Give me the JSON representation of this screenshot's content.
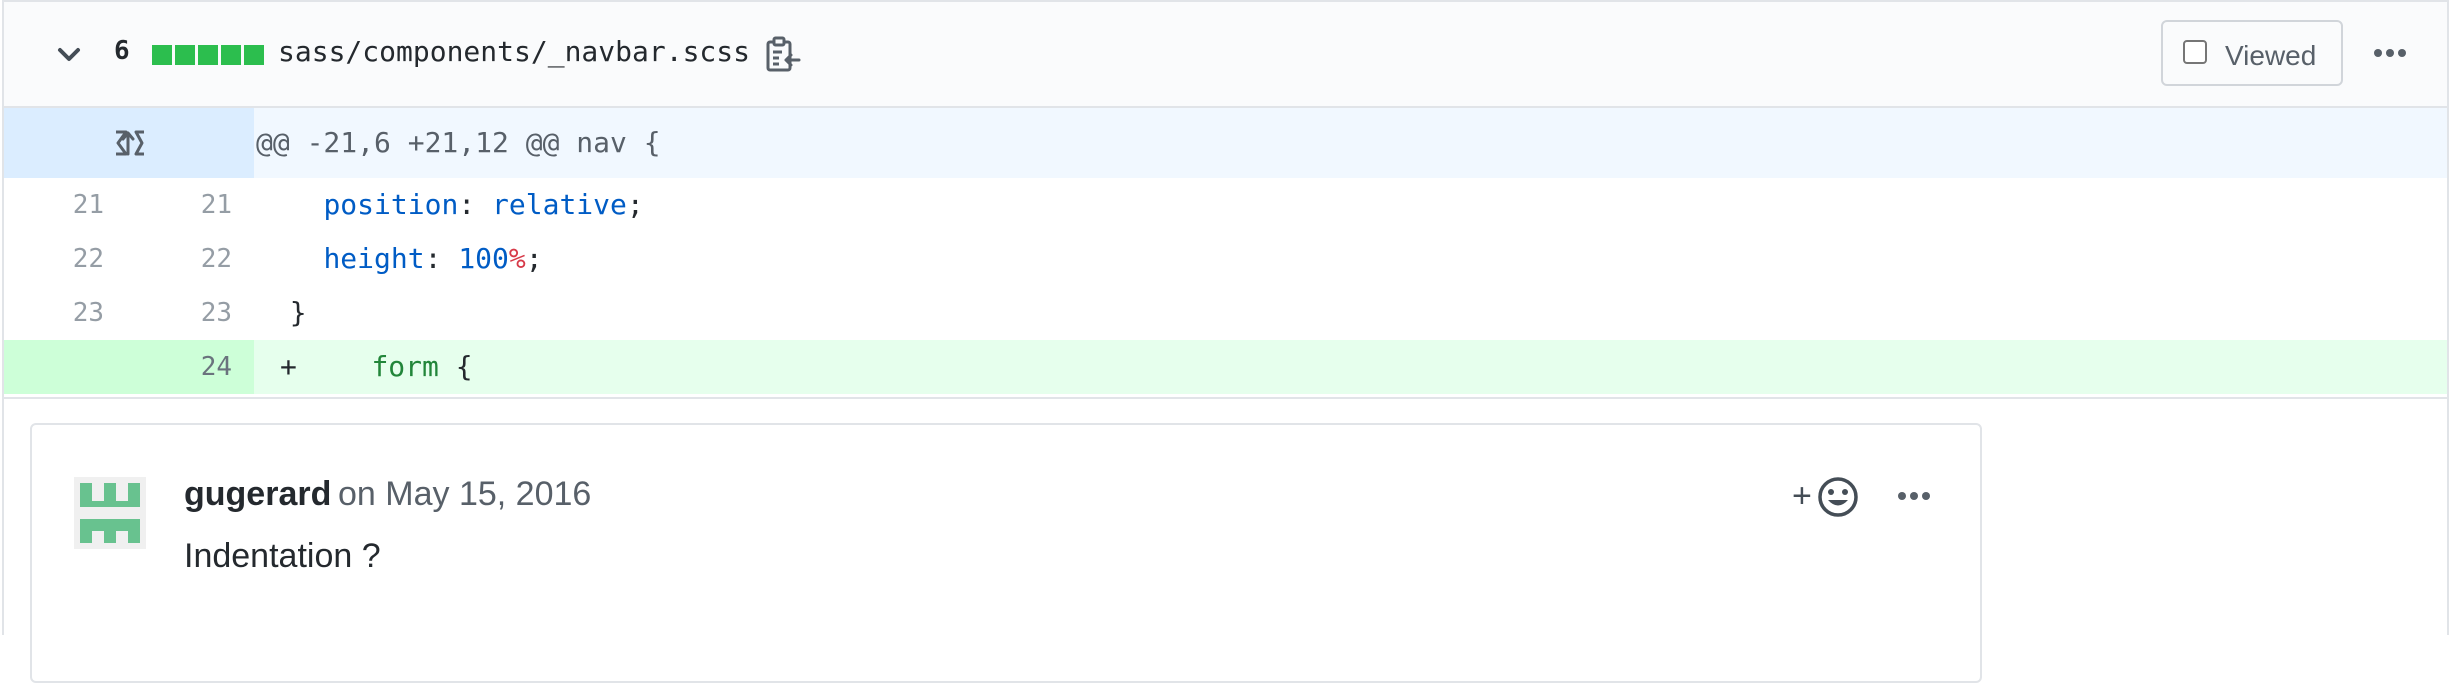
{
  "file": {
    "changes": "6",
    "diffstat_blocks": 5,
    "diffstat_color": "#2cbe4e",
    "path": "sass/components/_navbar.scss",
    "viewed_label": "Viewed",
    "viewed_checked": false,
    "icons": {
      "collapse": "chevron-down-icon",
      "copy": "clipboard-copy-icon",
      "menu": "kebab-horizontal-icon"
    }
  },
  "hunk": {
    "header": "@@ -21,6 +21,12 @@ nav {",
    "expand_icon": "unfold-icon"
  },
  "lines": [
    {
      "old": "21",
      "new": "21",
      "indent": "    ",
      "prop": "position",
      "sep": ": ",
      "val": "relative",
      "unit": "",
      "end": ";"
    },
    {
      "old": "22",
      "new": "22",
      "indent": "    ",
      "prop": "height",
      "sep": ": ",
      "val": "100",
      "unit": "%",
      "end": ";"
    },
    {
      "old": "23",
      "new": "23",
      "text": "  }"
    }
  ],
  "added_line": {
    "new": "24",
    "marker": "+",
    "indent": "    ",
    "tag": "form",
    "rest": " {"
  },
  "comment": {
    "author": "gugerard",
    "date": "on May 15, 2016",
    "body": "Indentation ?",
    "react_label": "+",
    "icons": {
      "reaction": "smiley-icon",
      "menu": "kebab-horizontal-icon",
      "avatar": "identicon-avatar"
    }
  }
}
